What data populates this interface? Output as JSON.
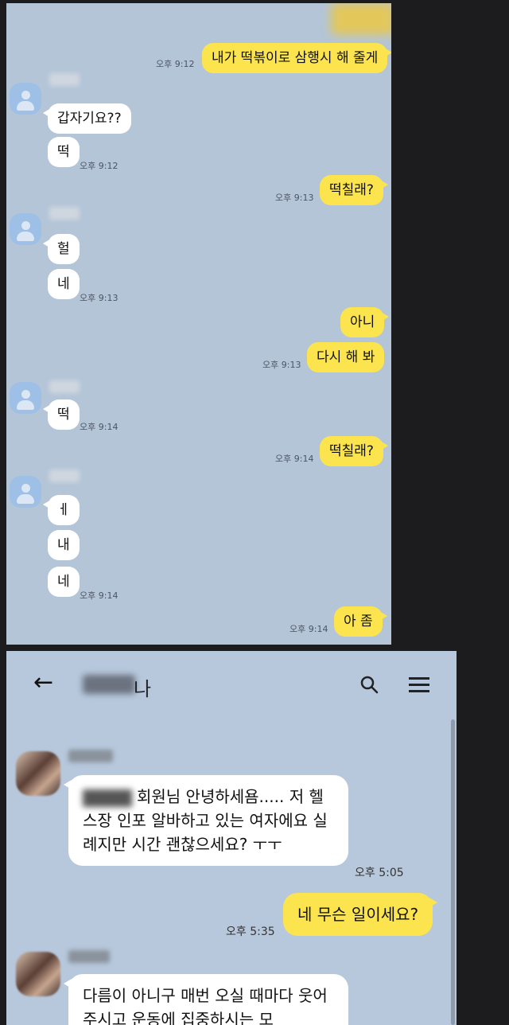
{
  "panel1": {
    "messages": [
      {
        "text": "내가 떡볶이로 삼행시 해 줄게",
        "time": "오후 9:12"
      },
      {
        "text": "갑자기요??"
      },
      {
        "text": "떡",
        "time": "오후 9:12"
      },
      {
        "text": "떡칠래?",
        "time": "오후 9:13"
      },
      {
        "text": "헐"
      },
      {
        "text": "네",
        "time": "오후 9:13"
      },
      {
        "text": "아니"
      },
      {
        "text": "다시 해 봐",
        "time": "오후 9:13"
      },
      {
        "text": "떡",
        "time": "오후 9:14"
      },
      {
        "text": "떡칠래?",
        "time": "오후 9:14"
      },
      {
        "text": "ㅔ"
      },
      {
        "text": "내"
      },
      {
        "text": "네",
        "time": "오후 9:14"
      },
      {
        "text": "아 좀",
        "time": "오후 9:14"
      }
    ]
  },
  "panel2": {
    "title_suffix": "나",
    "icons": {
      "back": "back-arrow-icon",
      "search": "search-icon",
      "menu": "hamburger-menu-icon"
    },
    "messages": [
      {
        "text": "회원님 안녕하세욤..... 저 헬스장 인포 알바하고 있는 여자에요 실례지만 시간 괜찮으세요? ㅜㅜ",
        "time": "오후 5:05"
      },
      {
        "text": "네 무슨 일이세요?",
        "time": "오후 5:35"
      },
      {
        "text": "다름이 아니구 매번 오실 때마다 웃어주시고 운동에 집중하시는 모"
      }
    ]
  },
  "colors": {
    "bg": "#1c1c1e",
    "chat_bg": "#b4c5d8",
    "my_bubble": "#fbe44d",
    "their_bubble": "#ffffff"
  }
}
